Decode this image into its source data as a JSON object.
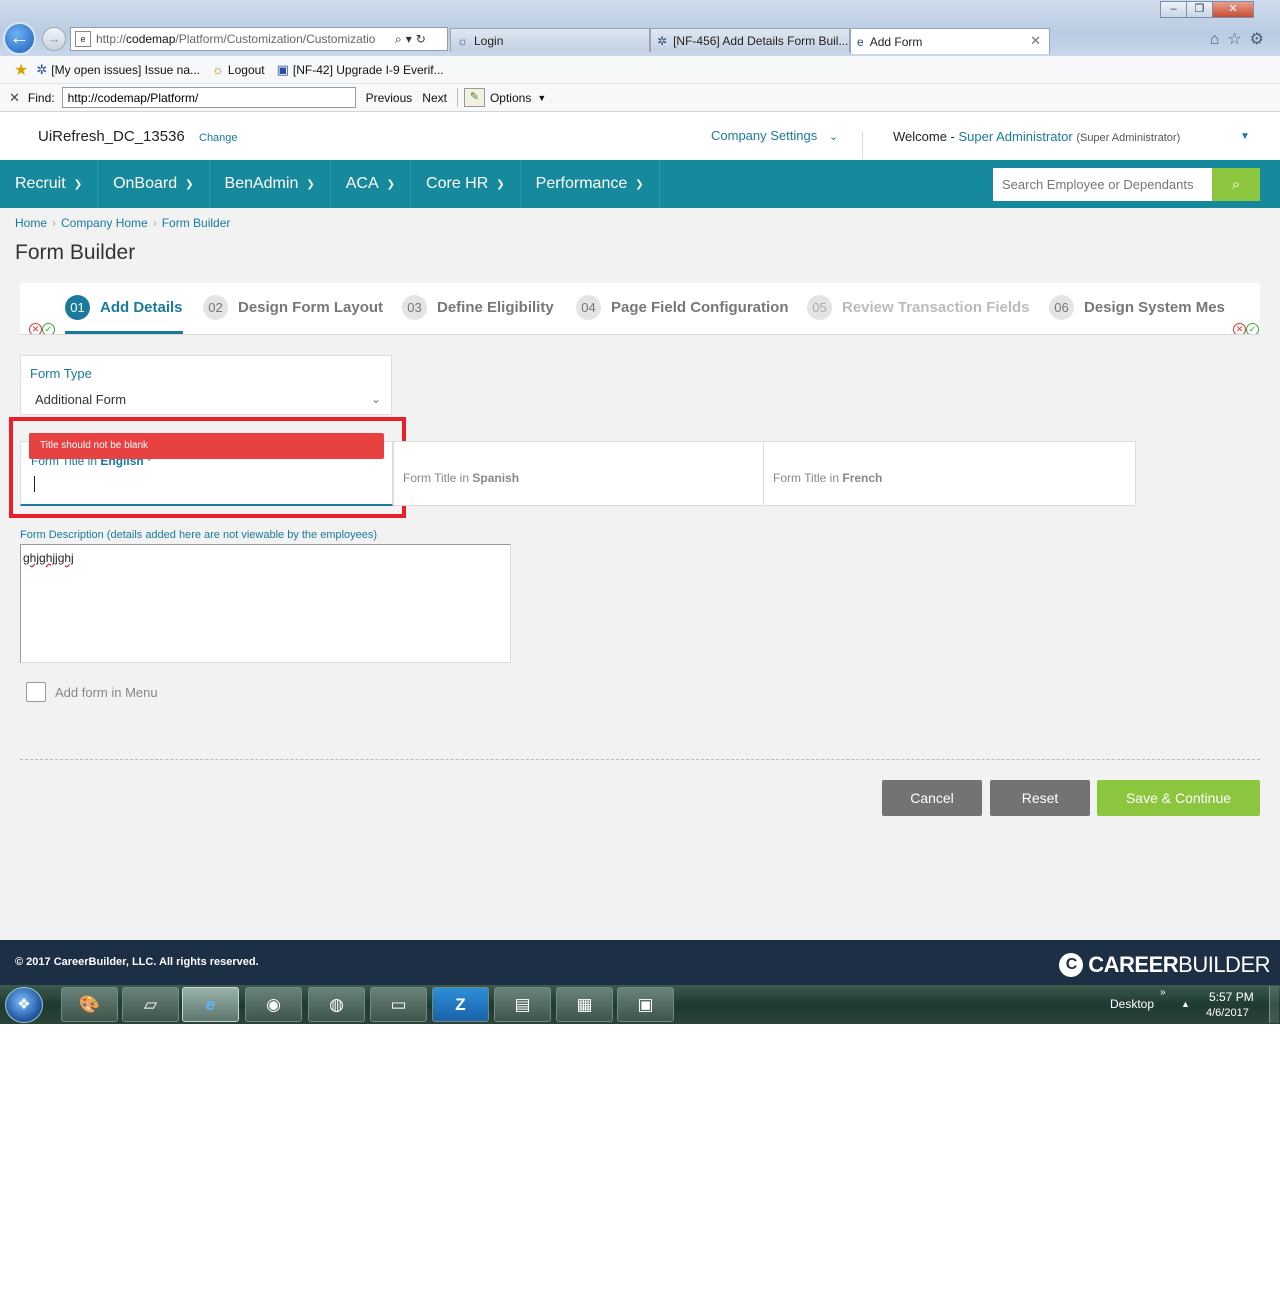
{
  "browser": {
    "address_url_prefix": "http://",
    "address_url_host": "codemap",
    "address_url_path": "/Platform/Customization/Customizatio",
    "address_tools": "⌕▾↻",
    "window_controls": {
      "minimize": "–",
      "maximize": "❐",
      "close": "✕"
    },
    "tabs": [
      {
        "label": "Login"
      },
      {
        "label": "[NF-456] Add Details Form Buil..."
      },
      {
        "label": "Add Form",
        "active": true
      }
    ],
    "favorites": [
      {
        "label": "[My open issues] Issue na..."
      },
      {
        "label": "Logout"
      },
      {
        "label": "[NF-42] Upgrade I-9 Everif..."
      }
    ],
    "find": {
      "label": "Find:",
      "value": "http://codemap/Platform/",
      "previous": "Previous",
      "next": "Next",
      "options": "Options"
    }
  },
  "header": {
    "company": "UiRefresh_DC_13536",
    "change": "Change",
    "company_settings": "Company Settings",
    "welcome": "Welcome -",
    "user_name": "Super Administrator",
    "user_role": "(Super Administrator)"
  },
  "nav": {
    "items": [
      {
        "label": "Recruit"
      },
      {
        "label": "OnBoard"
      },
      {
        "label": "BenAdmin"
      },
      {
        "label": "ACA"
      },
      {
        "label": "Core HR"
      },
      {
        "label": "Performance"
      }
    ],
    "search_placeholder": "Search Employee or Dependants"
  },
  "breadcrumb": [
    "Home",
    "Company Home",
    "Form Builder"
  ],
  "page_title": "Form Builder",
  "steps": [
    {
      "num": "01",
      "label": "Add Details",
      "state": "active"
    },
    {
      "num": "02",
      "label": "Design Form Layout",
      "state": "normal"
    },
    {
      "num": "03",
      "label": "Define Eligibility",
      "state": "normal"
    },
    {
      "num": "04",
      "label": "Page Field Configuration",
      "state": "normal"
    },
    {
      "num": "05",
      "label": "Review Transaction Fields",
      "state": "disabled"
    },
    {
      "num": "06",
      "label": "Design System Mes",
      "state": "normal"
    }
  ],
  "form": {
    "form_type_label": "Form Type",
    "form_type_value": "Additional Form",
    "title_english_prefix": "Form Title in",
    "title_english_lang": "English",
    "title_english_req": "*",
    "title_english_value": "",
    "error": "Title should not be blank",
    "title_spanish_prefix": "Form Title in",
    "title_spanish_lang": "Spanish",
    "title_french_prefix": "Form Title in",
    "title_french_lang": "French",
    "description_label": "Form Description (details added here are not viewable by the employees)",
    "description_value": "ghjghjjghj",
    "add_to_menu_label": "Add form in Menu",
    "add_to_menu_checked": false
  },
  "actions": {
    "cancel": "Cancel",
    "reset": "Reset",
    "save": "Save & Continue"
  },
  "footer": {
    "copyright": "© 2017 CareerBuilder, LLC. All rights reserved.",
    "logo_bold": "CAREER",
    "logo_light": "BUILDER"
  },
  "taskbar": {
    "desktop": "Desktop",
    "time": "5:57 PM",
    "date": "4/6/2017"
  },
  "colors": {
    "nav_bg": "#16899c",
    "accent": "#1a7a9e",
    "save_green": "#8cc63e",
    "error_red": "#e84141",
    "footer_bg": "#1c2f45"
  }
}
